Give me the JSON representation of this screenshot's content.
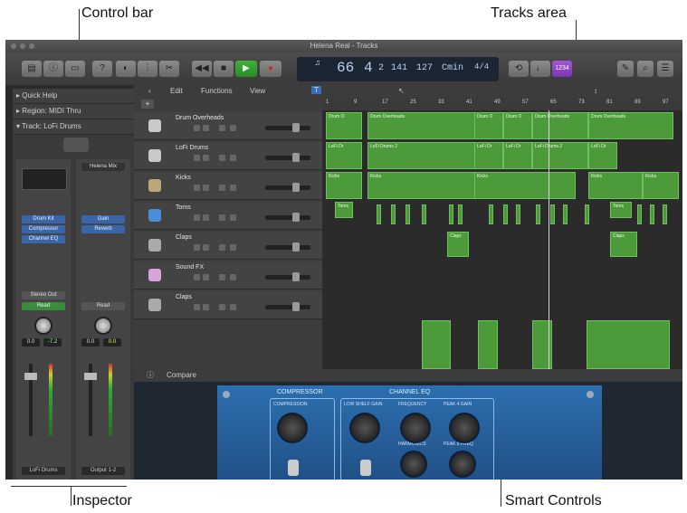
{
  "callouts": {
    "control_bar": "Control bar",
    "tracks_area": "Tracks area",
    "inspector": "Inspector",
    "smart_controls": "Smart Controls"
  },
  "window": {
    "title": "Helena Real - Tracks"
  },
  "lcd": {
    "beat1": "66",
    "beat2": "4",
    "beat3": "2",
    "beat4": "141",
    "tempo": "127",
    "key": "Cmin",
    "signature": "4/4"
  },
  "inspector": {
    "rows": [
      "Quick Help",
      "Region: MIDI Thru",
      "Track: LoFi Drums"
    ],
    "strip1": {
      "plugins": [
        "Drum Kit",
        "Compressor",
        "Channel EQ"
      ],
      "send_label": "Stereo Out",
      "read": "Read",
      "name": "LoFi Drums",
      "val1": "0.0",
      "val2": "-7.2"
    },
    "strip2": {
      "top": "Helena Mix",
      "plugins": [
        "Gain",
        "Reverb"
      ],
      "read": "Read",
      "name": "Output 1-2",
      "val1": "0.0",
      "val2": "0.0"
    }
  },
  "tracksbar": {
    "edit": "Edit",
    "functions": "Functions",
    "view": "View"
  },
  "tracks": [
    {
      "name": "Drum Overheads"
    },
    {
      "name": "LoFi Drums"
    },
    {
      "name": "Kicks"
    },
    {
      "name": "Toms"
    },
    {
      "name": "Claps"
    },
    {
      "name": "Sound FX"
    },
    {
      "name": "Claps"
    }
  ],
  "ruler": [
    "1",
    "9",
    "17",
    "25",
    "33",
    "41",
    "49",
    "57",
    "65",
    "73",
    "81",
    "89",
    "97"
  ],
  "regions": {
    "drum_overheads": [
      "Drum O",
      "Drum Overheads",
      "Drum O",
      "Drum O",
      "Drum Overheads",
      "Drum Overheads"
    ],
    "lofi": [
      "LoFi Dr",
      "LoFi Drums 2",
      "LoFi Dr",
      "LoFi Dr",
      "LoFi Drums 2",
      "LoFi Dr"
    ],
    "kicks": [
      "Kicks",
      "Kicks",
      "Kicks",
      "Kicks",
      "Kicks"
    ],
    "toms": [
      "Toms",
      "Toms"
    ],
    "claps": [
      "Claps",
      "Claps"
    ]
  },
  "smart": {
    "header": "Compare",
    "compressor": "COMPRESSOR",
    "eq": "CHANNEL EQ",
    "labels": [
      "COMPRESSION",
      "LOW SHELF GAIN",
      "FREQUENCY",
      "PEAK 4 GAIN",
      "HARMONICS",
      "PEAK 8 FREQ"
    ]
  }
}
